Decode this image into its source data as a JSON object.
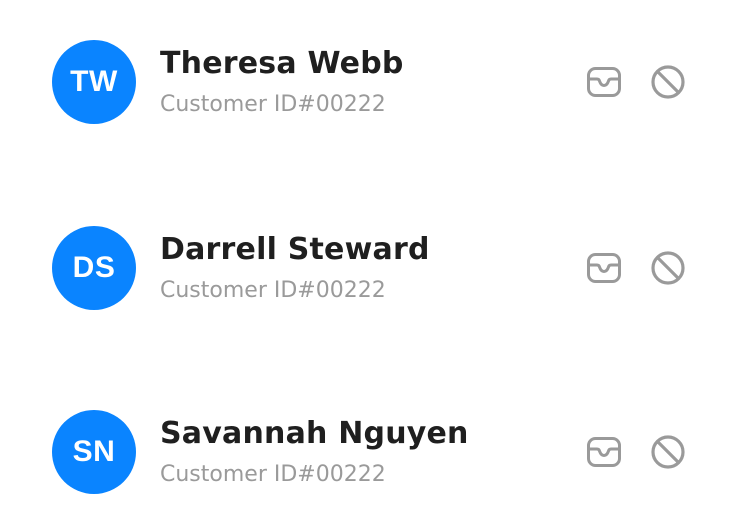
{
  "customers": [
    {
      "initials": "TW",
      "name": "Theresa Webb",
      "subtitle": "Customer ID#00222"
    },
    {
      "initials": "DS",
      "name": "Darrell Steward",
      "subtitle": "Customer ID#00222"
    },
    {
      "initials": "SN",
      "name": "Savannah Nguyen",
      "subtitle": "Customer ID#00222"
    }
  ],
  "colors": {
    "avatar_bg": "#0a84ff",
    "name_text": "#1f1f1f",
    "subtitle_text": "#9a9a9a",
    "icon": "#9a9a9a"
  },
  "icons": {
    "message": "inbox-icon",
    "block": "block-icon"
  }
}
